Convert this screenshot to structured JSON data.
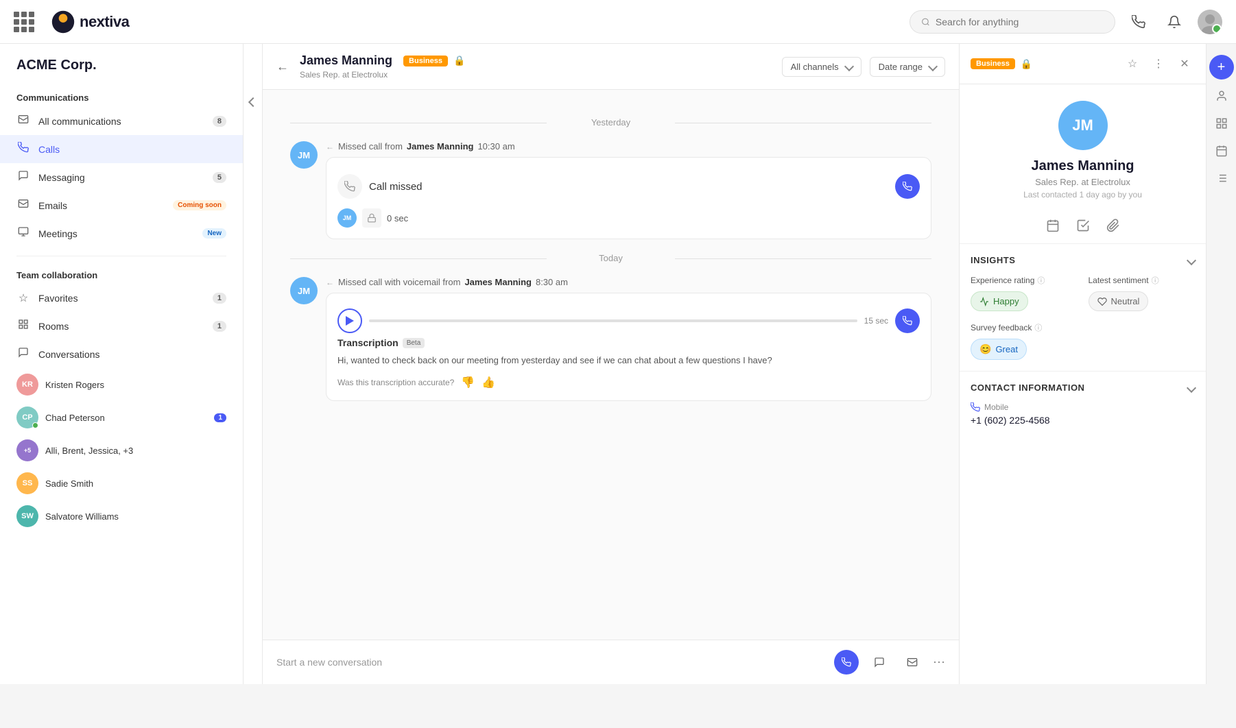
{
  "app": {
    "logo_text": "nextiva",
    "search_placeholder": "Search for anything"
  },
  "sidebar": {
    "company": "ACME Corp.",
    "communications_title": "Communications",
    "items": [
      {
        "label": "All communications",
        "badge": "8",
        "icon": "✉",
        "active": false
      },
      {
        "label": "Calls",
        "badge": "",
        "icon": "📞",
        "active": true
      },
      {
        "label": "Messaging",
        "badge": "5",
        "icon": "💬",
        "active": false
      },
      {
        "label": "Emails",
        "badge": "Coming soon",
        "badge_type": "coming-soon",
        "icon": "✉",
        "active": false
      },
      {
        "label": "Meetings",
        "badge": "New",
        "badge_type": "new",
        "icon": "🖥",
        "active": false
      }
    ],
    "team_title": "Team collaboration",
    "team_items": [
      {
        "label": "Favorites",
        "badge": "1",
        "icon": "☆"
      },
      {
        "label": "Rooms",
        "badge": "1",
        "icon": "📋"
      },
      {
        "label": "Conversations",
        "badge": "",
        "icon": "💬"
      }
    ],
    "conversations_title": "Conversations",
    "conversations": [
      {
        "name": "Kristen Rogers",
        "badge": "",
        "color": "#ef9a9a"
      },
      {
        "name": "Chad Peterson",
        "badge": "1",
        "color": "#80cbc4"
      },
      {
        "name": "Alli, Brent, Jessica, +3",
        "badge": "",
        "color": "#9575cd"
      },
      {
        "name": "Sadie Smith",
        "badge": "",
        "color": "#ffb74d"
      },
      {
        "name": "Salvatore Williams",
        "badge": "",
        "color": "#4db6ac"
      }
    ]
  },
  "chat": {
    "contact_name": "James Manning",
    "contact_tag": "Business",
    "contact_subtitle": "Sales Rep. at Electrolux",
    "filter_all_channels": "All channels",
    "filter_date_range": "Date range",
    "date_yesterday": "Yesterday",
    "date_today": "Today",
    "missed_call_header": "Missed call from",
    "missed_call_name": "James Manning",
    "missed_call_time": "10:30 am",
    "missed_call_label": "Call missed",
    "voicemail_header": "Missed call with voicemail from",
    "voicemail_name": "James Manning",
    "voicemail_time": "8:30 am",
    "voicemail_duration": "15 sec",
    "voicemail_duration_sub": "0 sec",
    "transcription_label": "Transcription",
    "beta_label": "Beta",
    "transcript_text": "Hi, wanted to check back on our meeting from yesterday and see if we can chat about a few questions I have?",
    "accurate_question": "Was this transcription accurate?",
    "input_placeholder": "Start a new conversation",
    "avatar_initials": "JM",
    "avatar_bg": "#64b5f6"
  },
  "right_panel": {
    "business_tag": "Business",
    "avatar_initials": "JM",
    "avatar_bg": "#64b5f6",
    "name": "James Manning",
    "title": "Sales Rep. at Electrolux",
    "last_contacted": "Last contacted 1 day ago by you",
    "insights_title": "INSIGHTS",
    "experience_rating_label": "Experience rating",
    "latest_sentiment_label": "Latest sentiment",
    "experience_value": "Happy",
    "sentiment_value": "Neutral",
    "survey_feedback_label": "Survey feedback",
    "survey_value": "Great",
    "contact_info_title": "CONTACT INFORMATION",
    "mobile_label": "Mobile",
    "mobile_value": "+1 (602) 225-4568"
  }
}
